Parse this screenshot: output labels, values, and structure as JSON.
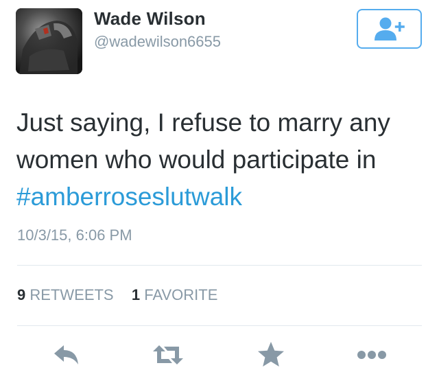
{
  "user": {
    "display_name": "Wade Wilson",
    "handle": "@wadewilson6655"
  },
  "follow_button": {
    "icon": "add-user-icon"
  },
  "tweet": {
    "text_line1": "Just saying, I refuse to marry any",
    "text_line2": "women who would participate in",
    "hashtag": "#amberroseslutwalk",
    "timestamp": "10/3/15, 6:06 PM"
  },
  "stats": {
    "retweet_count": "9",
    "retweet_label": "RETWEETS",
    "favorite_count": "1",
    "favorite_label": "FAVORITE"
  },
  "actions": [
    "reply-icon",
    "retweet-icon",
    "favorite-star-icon",
    "more-icon"
  ],
  "colors": {
    "accent": "#55acee",
    "hashtag": "#2b9bd8",
    "icon_gray": "#8899a6",
    "text": "#292f33"
  }
}
